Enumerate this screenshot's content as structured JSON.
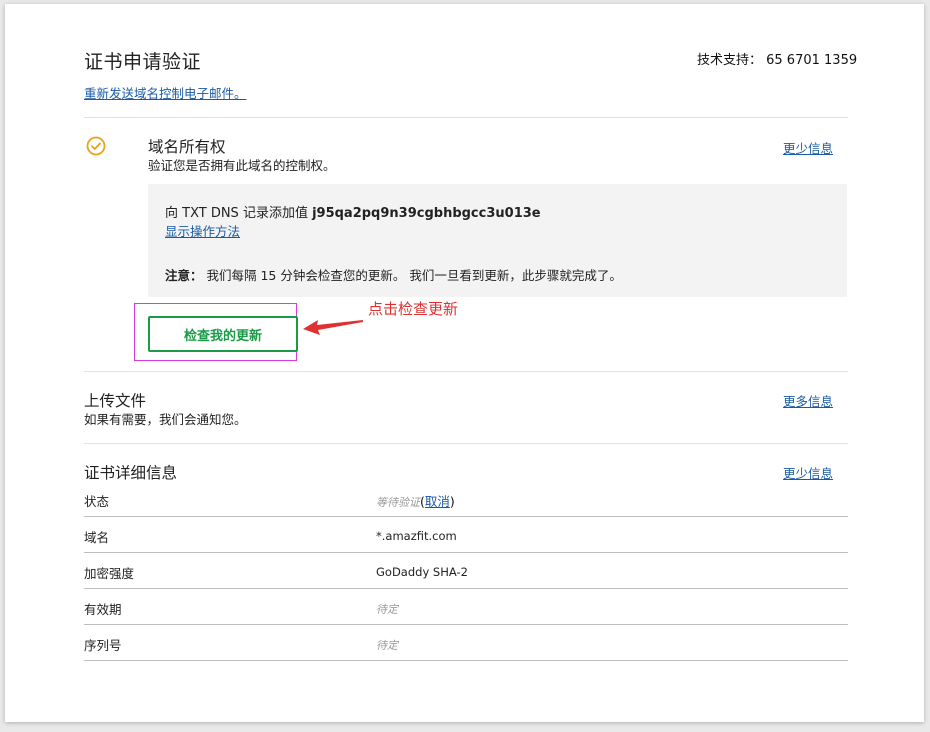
{
  "header": {
    "title": "证书申请验证",
    "support": "技术支持： 65 6701 1359",
    "resend_link": "重新发送域名控制电子邮件。"
  },
  "domain_ownership": {
    "title": "域名所有权",
    "description": "验证您是否拥有此域名的控制权。",
    "toggle_link": "更少信息",
    "dns_prefix": "向 TXT DNS 记录添加值 ",
    "dns_value": "j95qa2pq9n39cgbhbgcc3u013e",
    "show_how_link": "显示操作方法",
    "note_label": "注意：",
    "note_text": " 我们每隔 15 分钟会检查您的更新。 我们一旦看到更新，此步骤就完成了。",
    "check_button": "检查我的更新",
    "annotation": "点击检查更新",
    "status_icon": "check-circle-icon",
    "status_color": "#e8a317"
  },
  "upload_file": {
    "title": "上传文件",
    "description": "如果有需要，我们会通知您。",
    "toggle_link": "更多信息"
  },
  "cert_details": {
    "title": "证书详细信息",
    "toggle_link": "更少信息",
    "rows": [
      {
        "label": "状态",
        "value": "等待验证",
        "action": "取消"
      },
      {
        "label": "域名",
        "value": "*.amazfit.com"
      },
      {
        "label": "加密强度",
        "value": "GoDaddy SHA-2"
      },
      {
        "label": "有效期",
        "value": "待定"
      },
      {
        "label": "序列号",
        "value": "待定"
      }
    ]
  },
  "colors": {
    "link": "#1a5ba3",
    "button_green": "#1a9c47",
    "annotation_red": "#e03030",
    "highlight_magenta": "#d63cdb"
  }
}
